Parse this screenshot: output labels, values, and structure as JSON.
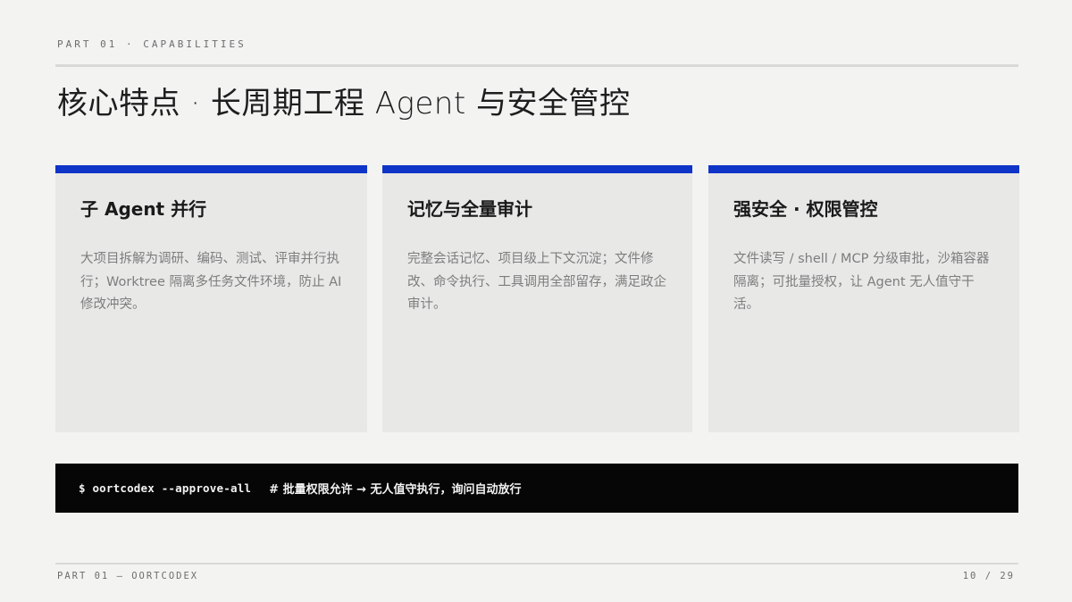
{
  "header": {
    "eyebrow": "PART 01 · CAPABILITIES",
    "title": "核心特点 · 长周期工程 Agent 与安全管控"
  },
  "cards": [
    {
      "title": "子 Agent 并行",
      "body": "大项目拆解为调研、编码、测试、评审并行执行；Worktree 隔离多任务文件环境，防止 AI 修改冲突。"
    },
    {
      "title": "记忆与全量审计",
      "body": "完整会话记忆、项目级上下文沉淀；文件修改、命令执行、工具调用全部留存，满足政企审计。"
    },
    {
      "title": "强安全 · 权限管控",
      "body": "文件读写 / shell / MCP 分级审批，沙箱容器隔离；可批量授权，让 Agent 无人值守干活。"
    }
  ],
  "command": {
    "text": "$ oortcodex --approve-all",
    "comment": "# 批量权限允许 → 无人值守执行，询问自动放行"
  },
  "footer": {
    "left": "PART 01 — OORTCODEX",
    "right": "10 / 29"
  },
  "colors": {
    "accent": "#0f34c8",
    "background": "#f3f3f2",
    "card": "#e8e8e7",
    "command_bar": "#060606"
  }
}
